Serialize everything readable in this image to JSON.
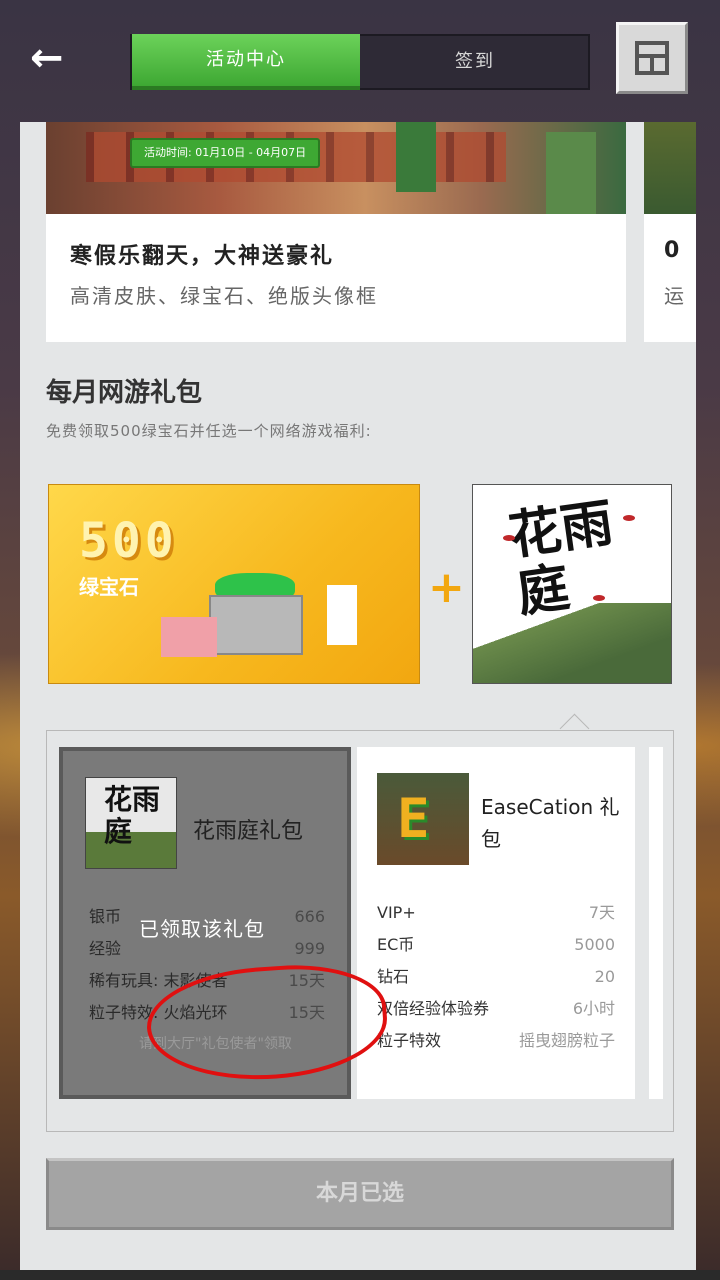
{
  "topbar": {
    "back_icon": "arrow-left-icon",
    "tabs": [
      {
        "label": "活动中心",
        "active": true
      },
      {
        "label": "签到",
        "active": false
      }
    ],
    "menu_icon": "window-menu-icon"
  },
  "banners": [
    {
      "date_badge": "活动时间: 01月10日 - 04月07日",
      "title": "寒假乐翻天，大神送豪礼",
      "subtitle": "高清皮肤、绿宝石、绝版头像框"
    },
    {
      "title": "0",
      "subtitle": "运"
    }
  ],
  "section": {
    "title": "每月网游礼包",
    "subtitle": "免费领取500绿宝石并任选一个网络游戏福利:"
  },
  "emerald_gift": {
    "number": "500",
    "label": "绿宝石"
  },
  "plus_sign": "+",
  "featured_game_logo": "花雨庭",
  "packs": [
    {
      "thumb_logo": "花雨庭",
      "name": "花雨庭礼包",
      "selected": true,
      "rows": [
        {
          "k": "银币",
          "v": "666"
        },
        {
          "k": "经验",
          "v": "999"
        },
        {
          "k": "稀有玩具: 末影使者",
          "v": "15天"
        },
        {
          "k": "粒子特效: 火焰光环",
          "v": "15天"
        }
      ],
      "claimed_text": "已领取该礼包",
      "hint": "请到大厅\"礼包使者\"领取"
    },
    {
      "thumb_logo": "E",
      "name": "EaseCation 礼包",
      "selected": false,
      "rows": [
        {
          "k": "VIP+",
          "v": "7天"
        },
        {
          "k": "EC币",
          "v": "5000"
        },
        {
          "k": "钻石",
          "v": "20"
        },
        {
          "k": "双倍经验体验券",
          "v": "6小时"
        },
        {
          "k": "粒子特效",
          "v": "摇曳翅膀粒子"
        }
      ]
    }
  ],
  "bottom_button": "本月已选",
  "colors": {
    "accent_green": "#3ea833",
    "gold": "#f2a710",
    "annotation_red": "#e01010"
  }
}
